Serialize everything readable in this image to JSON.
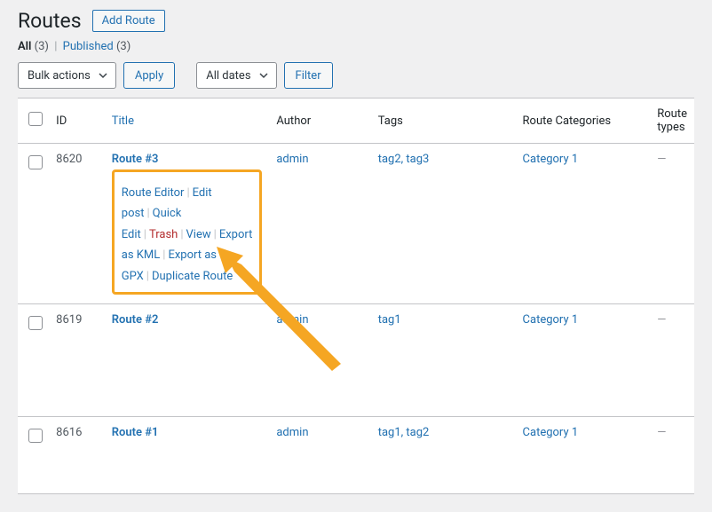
{
  "page": {
    "title": "Routes",
    "add_button": "Add Route"
  },
  "filters": {
    "all_label": "All",
    "all_count": "(3)",
    "published_label": "Published",
    "published_count": "(3)"
  },
  "toolbar": {
    "bulk_label": "Bulk actions",
    "apply_label": "Apply",
    "date_label": "All dates",
    "filter_label": "Filter"
  },
  "columns": {
    "id": "ID",
    "title": "Title",
    "author": "Author",
    "tags": "Tags",
    "route_categories": "Route Categories",
    "route_types": "Route types"
  },
  "row_actions": {
    "route_editor": "Route Editor",
    "edit_post": "Edit post",
    "quick_edit": "Quick Edit",
    "trash": "Trash",
    "view": "View",
    "export_kml": "Export as KML",
    "export_gpx": "Export as GPX",
    "duplicate_route": "Duplicate Route"
  },
  "rows": [
    {
      "id": "8620",
      "title": "Route #3",
      "author": "admin",
      "tags": "tag2, tag3",
      "categories": "Category 1",
      "types": "—"
    },
    {
      "id": "8619",
      "title": "Route #2",
      "author": "admin",
      "tags": "tag1",
      "categories": "Category 1",
      "types": "—"
    },
    {
      "id": "8616",
      "title": "Route #1",
      "author": "admin",
      "tags": "tag1, tag2",
      "categories": "Category 1",
      "types": "—"
    }
  ]
}
